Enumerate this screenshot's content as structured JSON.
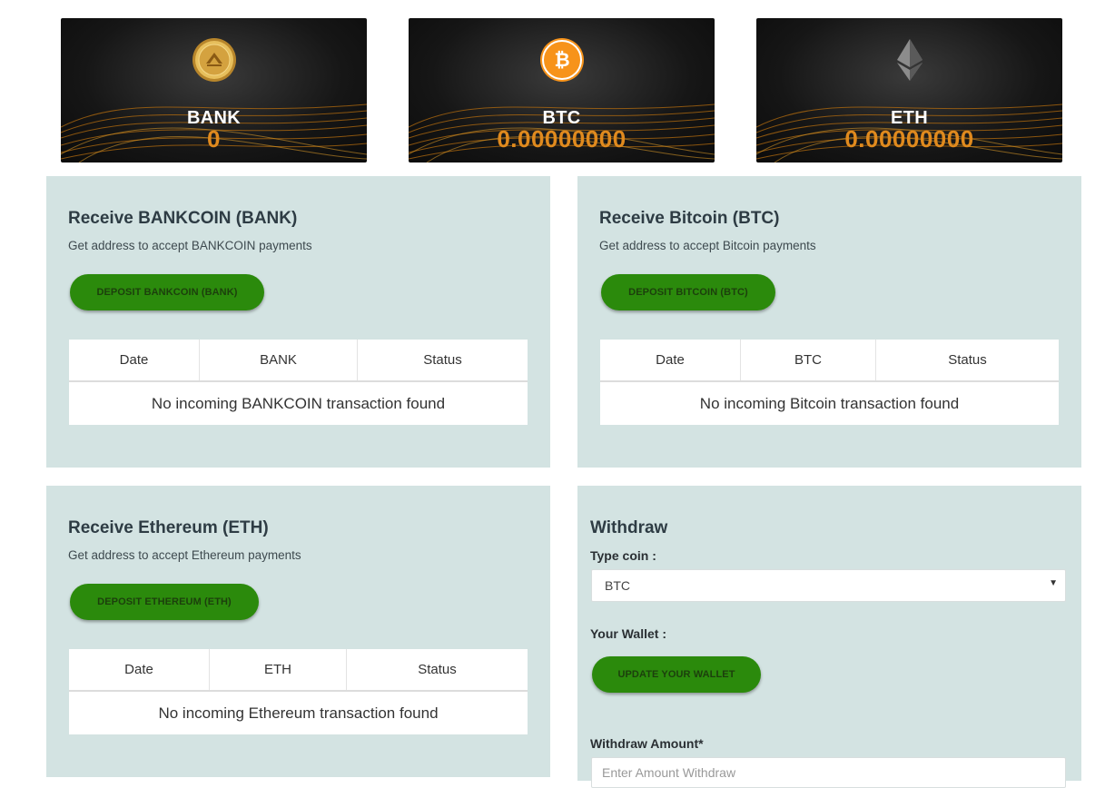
{
  "balances": {
    "bank": {
      "symbol": "BANK",
      "amount": "0"
    },
    "btc": {
      "symbol": "BTC",
      "amount": "0.00000000"
    },
    "eth": {
      "symbol": "ETH",
      "amount": "0.00000000"
    }
  },
  "receive_bank": {
    "title": "Receive BANKCOIN (BANK)",
    "subtitle": "Get address to accept BANKCOIN payments",
    "button": "DEPOSIT BANKCOIN (BANK)",
    "columns": [
      "Date",
      "BANK",
      "Status"
    ],
    "empty": "No incoming BANKCOIN transaction found"
  },
  "receive_btc": {
    "title": "Receive Bitcoin (BTC)",
    "subtitle": "Get address to accept Bitcoin payments",
    "button": "DEPOSIT BITCOIN (BTC)",
    "columns": [
      "Date",
      "BTC",
      "Status"
    ],
    "empty": "No incoming Bitcoin transaction found"
  },
  "receive_eth": {
    "title": "Receive Ethereum (ETH)",
    "subtitle": "Get address to accept Ethereum payments",
    "button": "DEPOSIT ETHEREUM (ETH)",
    "columns": [
      "Date",
      "ETH",
      "Status"
    ],
    "empty": "No incoming Ethereum transaction found"
  },
  "withdraw": {
    "title": "Withdraw",
    "type_coin_label": "Type coin :",
    "selected_coin": "BTC",
    "wallet_label": "Your Wallet :",
    "update_button": "UPDATE YOUR WALLET",
    "amount_label": "Withdraw Amount*",
    "amount_placeholder": "Enter Amount Withdraw"
  },
  "colors": {
    "panel_bg": "#d3e3e2",
    "button_green": "#2b8a0c",
    "amount_orange": "#e08a1e"
  },
  "icons": {
    "bank": "bankcoin-gold-coin-icon",
    "btc": "bitcoin-icon",
    "eth": "ethereum-icon"
  }
}
